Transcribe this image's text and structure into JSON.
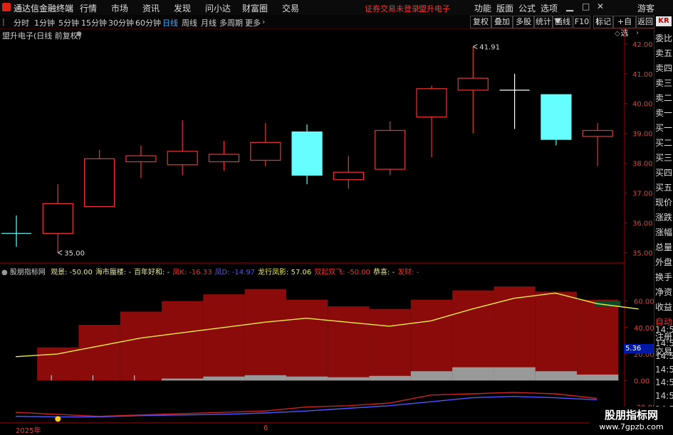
{
  "menubar": {
    "app_title": "通达信金融终端",
    "items": [
      "行情",
      "市场",
      "资讯",
      "发现",
      "问小达",
      "财富圈",
      "交易"
    ],
    "notice": "证券交易未登录",
    "stock_name": "盟升电子",
    "right_items": [
      "功能",
      "版面",
      "公式",
      "选项"
    ],
    "guest": "游客"
  },
  "toolbar": {
    "periods": [
      "分时",
      "1分钟",
      "5分钟",
      "15分钟",
      "30分钟",
      "60分钟",
      "日线",
      "周线",
      "月线",
      "多周期",
      "更多"
    ],
    "active_period": "日线",
    "buttons": [
      "复权",
      "叠加",
      "多股",
      "统计",
      "画线",
      "F10",
      "标记",
      "+自选",
      "返回"
    ]
  },
  "chart_header": {
    "title": "盟升电子(日线 前复权)"
  },
  "sidebar": {
    "badge": "KR",
    "items": [
      "委比",
      "卖五",
      "卖四",
      "卖三",
      "卖二",
      "卖一",
      "买一",
      "买二",
      "买三",
      "买四",
      "买五",
      "现价",
      "涨跌",
      "涨幅",
      "总量",
      "外盘",
      "换手",
      "净资",
      "收益",
      "自动",
      "注册",
      "交易"
    ],
    "times": [
      "14:55",
      "14:55",
      "14:56",
      "14:56",
      "14:56",
      "14:56",
      "14:56",
      "14:56"
    ]
  },
  "indicator": {
    "name": "股朋指标网",
    "labels": [
      {
        "text": "观景: -50.00",
        "color": "#e8e8a0"
      },
      {
        "text": "海市蜃楼: -",
        "color": "#e8e8a0"
      },
      {
        "text": "百年好和: -",
        "color": "#e8e8a0"
      },
      {
        "text": "凤K: -16.33",
        "color": "#e33"
      },
      {
        "text": "凤D: -14.97",
        "color": "#55f"
      },
      {
        "text": "龙行凤影: 57.06",
        "color": "#ee4"
      },
      {
        "text": "双起双飞: -50.00",
        "color": "#e33"
      },
      {
        "text": "恭喜: -",
        "color": "#e8e8a0"
      },
      {
        "text": "发财: -",
        "color": "#e33"
      }
    ],
    "readout": "5.36"
  },
  "xaxis": {
    "labels": [
      "2025年",
      "6"
    ]
  },
  "watermark": {
    "line1": "股朋指标网",
    "line2": "www.7gpzb.com"
  },
  "chart_data": [
    {
      "type": "candlestick",
      "title": "盟升电子(日线 前复权)",
      "ylim": [
        34.8,
        42.4
      ],
      "yticks": [
        35.0,
        36.0,
        37.0,
        38.0,
        39.0,
        40.0,
        41.0,
        42.0
      ],
      "annotations": [
        {
          "text": "41.91",
          "index": 11,
          "value": 41.91
        },
        {
          "text": "35.00",
          "index": 1,
          "value": 35.0
        }
      ],
      "candles": [
        {
          "o": 35.65,
          "h": 36.25,
          "l": 35.2,
          "c": 35.65,
          "color": "#6ff"
        },
        {
          "o": 35.65,
          "h": 37.3,
          "l": 35.0,
          "c": 36.65,
          "color": "#e33"
        },
        {
          "o": 36.55,
          "h": 38.45,
          "l": 36.55,
          "c": 38.15,
          "color": "#e33"
        },
        {
          "o": 38.05,
          "h": 38.6,
          "l": 37.5,
          "c": 38.25,
          "color": "#e33"
        },
        {
          "o": 37.95,
          "h": 39.45,
          "l": 37.6,
          "c": 38.4,
          "color": "#e33"
        },
        {
          "o": 38.05,
          "h": 38.75,
          "l": 37.75,
          "c": 38.3,
          "color": "#e33"
        },
        {
          "o": 38.1,
          "h": 39.35,
          "l": 37.9,
          "c": 38.7,
          "color": "#e33"
        },
        {
          "o": 39.05,
          "h": 39.3,
          "l": 37.3,
          "c": 37.6,
          "color": "#6ff"
        },
        {
          "o": 37.45,
          "h": 38.25,
          "l": 37.15,
          "c": 37.7,
          "color": "#e33"
        },
        {
          "o": 37.8,
          "h": 39.4,
          "l": 37.6,
          "c": 39.1,
          "color": "#e33"
        },
        {
          "o": 39.55,
          "h": 40.6,
          "l": 38.2,
          "c": 40.5,
          "color": "#e33"
        },
        {
          "o": 40.45,
          "h": 41.91,
          "l": 39.0,
          "c": 40.85,
          "color": "#e33"
        },
        {
          "o": 40.45,
          "h": 41.0,
          "l": 39.15,
          "c": 40.45,
          "color": "#fff"
        },
        {
          "o": 40.3,
          "h": 40.3,
          "l": 38.6,
          "c": 38.8,
          "color": "#6ff"
        },
        {
          "o": 38.9,
          "h": 39.35,
          "l": 37.9,
          "c": 39.1,
          "color": "#e33"
        }
      ]
    },
    {
      "type": "bar",
      "title": "股朋指标网",
      "ylim": [
        -32,
        86
      ],
      "yticks": [
        60.0,
        40.0,
        20.0,
        0.0,
        -20.0
      ],
      "red_bars": [
        0,
        25,
        42,
        52,
        60,
        65,
        69,
        61,
        56,
        54,
        61,
        68,
        71,
        67,
        61
      ],
      "green_bars": [
        -5,
        -7,
        0,
        0,
        0,
        0,
        0,
        0,
        0,
        0,
        0,
        0,
        0,
        0,
        0
      ],
      "gray_bars": [
        0,
        0,
        0,
        0,
        1.5,
        3,
        4,
        3,
        2.5,
        3.5,
        7,
        10,
        10,
        7,
        4.5
      ],
      "dragon_line": [
        18,
        20,
        26,
        32,
        36,
        40,
        44,
        47,
        44,
        41,
        45,
        54,
        62,
        66,
        58,
        54
      ],
      "k_line": [
        -24,
        -25.5,
        -27,
        -26,
        -25,
        -24,
        -23,
        -20,
        -19,
        -17,
        -11,
        -10,
        -9,
        -10,
        -13.5
      ],
      "d_line": [
        -27,
        -27.5,
        -27.5,
        -26.5,
        -26,
        -25.5,
        -24.5,
        -23,
        -21,
        -19,
        -16,
        -13,
        -12,
        -13,
        -14.5
      ],
      "marker": {
        "index": 1,
        "value": -29
      }
    }
  ]
}
